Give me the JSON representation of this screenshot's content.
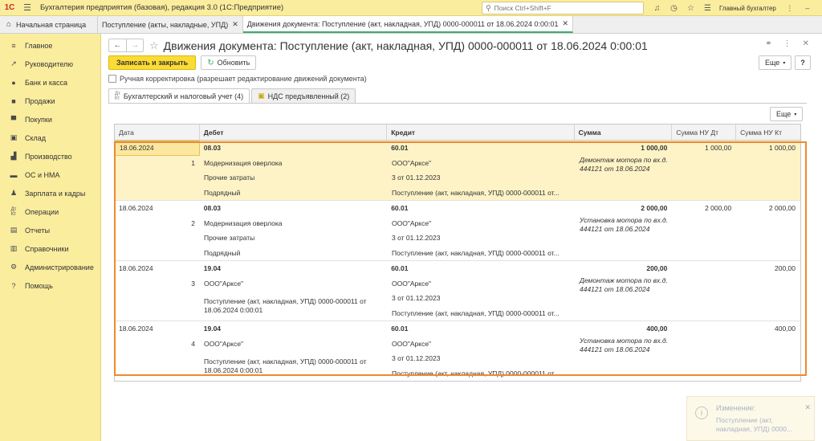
{
  "app": {
    "logo": "1С",
    "title": "Бухгалтерия предприятия (базовая), редакция 3.0  (1С:Предприятие)",
    "search_placeholder": "Поиск Ctrl+Shift+F",
    "user": "Главный бухгалтер"
  },
  "tabs": {
    "home": "Начальная страница",
    "items": [
      {
        "label": "Поступление (акты, накладные, УПД)"
      },
      {
        "label": "Движения документа: Поступление (акт, накладная, УПД) 0000-000011 от 18.06.2024 0:00:01"
      }
    ]
  },
  "sidebar": {
    "items": [
      {
        "label": "Главное",
        "icon": "menu-icon"
      },
      {
        "label": "Руководителю",
        "icon": "trend-icon"
      },
      {
        "label": "Банк и касса",
        "icon": "coins-icon"
      },
      {
        "label": "Продажи",
        "icon": "bag-icon"
      },
      {
        "label": "Покупки",
        "icon": "cart-icon"
      },
      {
        "label": "Склад",
        "icon": "box-icon"
      },
      {
        "label": "Производство",
        "icon": "factory-icon"
      },
      {
        "label": "ОС и НМА",
        "icon": "truck-icon"
      },
      {
        "label": "Зарплата и кадры",
        "icon": "people-icon"
      },
      {
        "label": "Операции",
        "icon": "dt-kt-icon"
      },
      {
        "label": "Отчеты",
        "icon": "report-icon"
      },
      {
        "label": "Справочники",
        "icon": "book-icon"
      },
      {
        "label": "Администрирование",
        "icon": "gear-icon"
      },
      {
        "label": "Помощь",
        "icon": "help-icon"
      }
    ]
  },
  "document": {
    "title": "Движения документа: Поступление (акт, накладная, УПД) 0000-000011 от 18.06.2024 0:00:01",
    "save_close": "Записать и закрыть",
    "refresh": "Обновить",
    "more": "Еще",
    "help": "?",
    "manual_correction": "Ручная корректировка (разрешает редактирование движений документа)",
    "subtabs": [
      {
        "label": "Бухгалтерский и налоговый учет (4)",
        "icon": "dt-kt-icon"
      },
      {
        "label": "НДС предъявленный (2)",
        "icon": "register-icon"
      }
    ]
  },
  "table": {
    "headers": [
      "Дата",
      "Дебет",
      "Кредит",
      "Сумма",
      "Сумма НУ Дт",
      "Сумма НУ Кт"
    ],
    "records": [
      {
        "date": "18.06.2024",
        "num": "1",
        "debit": [
          "08.03",
          "Модернизация оверлока",
          "Прочие затраты",
          "Подрядный"
        ],
        "credit": [
          "60.01",
          "ООО\"Арксе\"",
          "3 от 01.12.2023",
          "Поступление (акт, накладная, УПД) 0000-000011 от..."
        ],
        "sum": "1 000,00",
        "nu_dt": "1 000,00",
        "nu_kt": "1 000,00",
        "content": "Демонтаж мотора по вх.д. 444121 от 18.06.2024"
      },
      {
        "date": "18.06.2024",
        "num": "2",
        "debit": [
          "08.03",
          "Модернизация оверлока",
          "Прочие затраты",
          "Подрядный"
        ],
        "credit": [
          "60.01",
          "ООО\"Арксе\"",
          "3 от 01.12.2023",
          "Поступление (акт, накладная, УПД) 0000-000011 от..."
        ],
        "sum": "2 000,00",
        "nu_dt": "2 000,00",
        "nu_kt": "2 000,00",
        "content": "Установка мотора по вх.д. 444121 от 18.06.2024"
      },
      {
        "date": "18.06.2024",
        "num": "3",
        "debit": [
          "19.04",
          "ООО\"Арксе\"",
          "Поступление (акт, накладная, УПД) 0000-000011 от 18.06.2024 0:00:01"
        ],
        "credit": [
          "60.01",
          "ООО\"Арксе\"",
          "3 от 01.12.2023",
          "Поступление (акт, накладная, УПД) 0000-000011 от..."
        ],
        "sum": "200,00",
        "nu_dt": "",
        "nu_kt": "200,00",
        "content": "Демонтаж мотора по вх.д. 444121 от 18.06.2024"
      },
      {
        "date": "18.06.2024",
        "num": "4",
        "debit": [
          "19.04",
          "ООО\"Арксе\"",
          "Поступление (акт, накладная, УПД) 0000-000011 от 18.06.2024 0:00:01"
        ],
        "credit": [
          "60.01",
          "ООО\"Арксе\"",
          "3 от 01.12.2023",
          "Поступление (акт, накладная, УПД) 0000-000011 от..."
        ],
        "sum": "400,00",
        "nu_dt": "",
        "nu_kt": "400,00",
        "content": "Установка мотора по вх.д. 444121 от 18.06.2024"
      }
    ]
  },
  "notification": {
    "title": "Изменение:",
    "text": "Поступление (акт, накладная, УПД) 0000..."
  },
  "colors": {
    "accent_yellow": "#fcdb35",
    "sidebar_bg": "#fbed9e",
    "highlight_orange": "#ee8a2e",
    "active_tab_green": "#3cae70"
  }
}
